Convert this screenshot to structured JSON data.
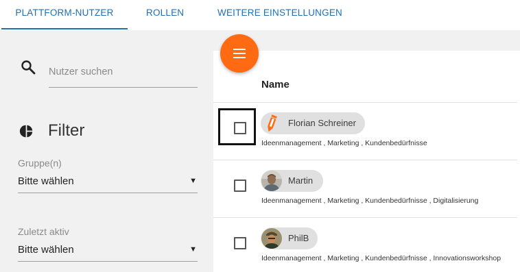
{
  "tabs": [
    {
      "label": "PLATTFORM-NUTZER",
      "active": true
    },
    {
      "label": "ROLLEN",
      "active": false
    },
    {
      "label": "WEITERE EINSTELLUNGEN",
      "active": false
    }
  ],
  "colors": {
    "accent": "#1e6fb3",
    "fab": "#ff6a13",
    "sidebar_bg": "#f1f1f1",
    "chip_bg": "#e0e0e0"
  },
  "sidebar": {
    "search": {
      "placeholder": "Nutzer suchen",
      "value": "",
      "icon": "search-icon"
    },
    "filter": {
      "title": "Filter",
      "icon": "pie-chart-icon"
    },
    "fields": [
      {
        "label": "Gruppe(n)",
        "value": "Bitte wählen"
      },
      {
        "label": "Zuletzt aktiv",
        "value": "Bitte wählen"
      }
    ]
  },
  "main": {
    "fab_icon": "menu-icon",
    "column_header": "Name",
    "users": [
      {
        "name": "Florian Schreiner",
        "avatar": "pencil-logo-icon",
        "groups": "Ideenmanagement , Marketing , Kundenbedürfnisse",
        "checked": false
      },
      {
        "name": "Martin",
        "avatar": "user-photo-avatar",
        "groups": "Ideenmanagement , Marketing , Kundenbedürfnisse , Digitalisierung",
        "checked": false
      },
      {
        "name": "PhilB",
        "avatar": "user-photo-avatar",
        "groups": "Ideenmanagement , Marketing , Kundenbedürfnisse , Innovationsworkshop",
        "checked": false
      }
    ]
  }
}
